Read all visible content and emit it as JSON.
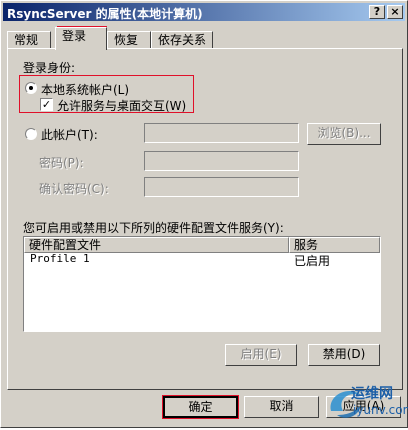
{
  "window": {
    "title": "RsyncServer 的属性(本地计算机)",
    "help_glyph": "?",
    "close_glyph": "×"
  },
  "tabs": [
    {
      "label": "常规"
    },
    {
      "label": "登录"
    },
    {
      "label": "恢复"
    },
    {
      "label": "依存关系"
    }
  ],
  "logon": {
    "group_label": "登录身份:",
    "local_system_label": "本地系统帐户(L)",
    "interact_label": "允许服务与桌面交互(W)",
    "this_account_label": "此帐户(T):",
    "browse_label": "浏览(B)...",
    "password_label": "密码(P):",
    "confirm_label": "确认密码(C):"
  },
  "profiles": {
    "caption": "您可启用或禁用以下所列的硬件配置文件服务(Y):",
    "columns": [
      "硬件配置文件",
      "服务"
    ],
    "rows": [
      {
        "profile": "Profile 1",
        "service": "已启用"
      }
    ],
    "enable_label": "启用(E)",
    "disable_label": "禁用(D)"
  },
  "footer": {
    "ok_label": "确定",
    "cancel_label": "取消",
    "apply_label": "应用(A)"
  },
  "watermark": {
    "text1": "运维网",
    "text2": "iyunv.com"
  },
  "colors": {
    "highlight": "#e0102a",
    "dialog_bg": "#d4d0c8",
    "title_start": "#0a246a",
    "title_end": "#a6caf0"
  }
}
